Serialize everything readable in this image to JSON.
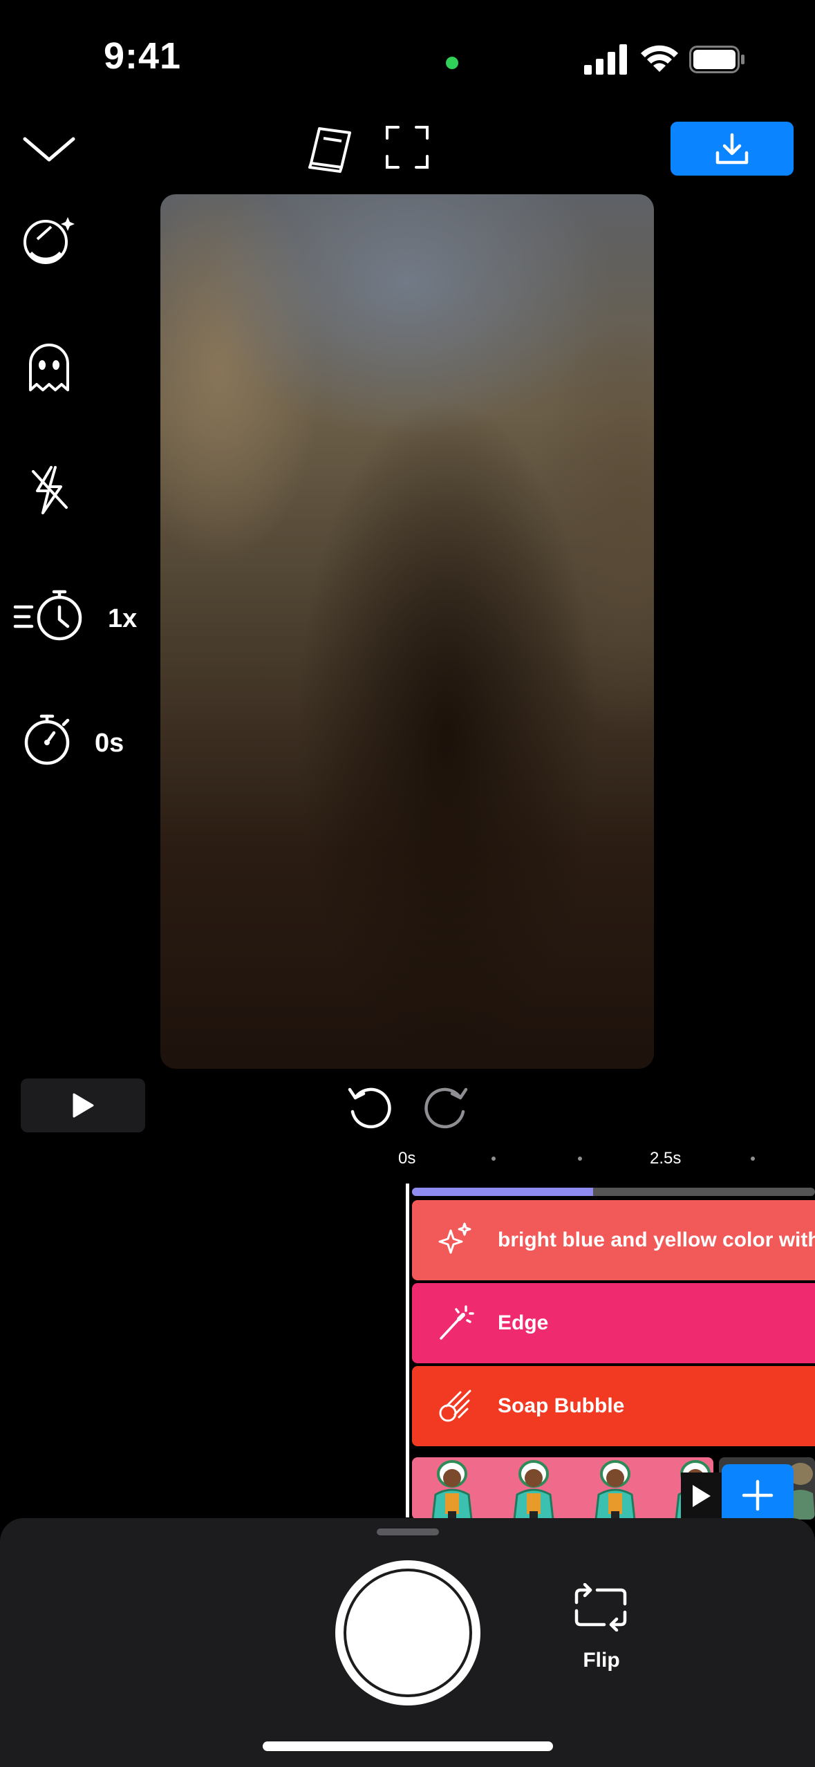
{
  "status_bar": {
    "time": "9:41"
  },
  "toolbar": {
    "export_icon": "download-icon",
    "export_color": "#0a84ff"
  },
  "side_tools": {
    "speed_label": "1x",
    "timer_label": "0s"
  },
  "timeline": {
    "ruler": [
      "0s",
      "2.5s"
    ],
    "progress": 0.45,
    "clips": [
      {
        "label": "bright blue and yellow color without r",
        "icon": "sparkles-icon",
        "color": "#f25a5a"
      },
      {
        "label": "Edge",
        "icon": "magic-wand-icon",
        "color": "#ef2a6e"
      },
      {
        "label": "Soap Bubble",
        "icon": "comet-icon",
        "color": "#f23a22"
      }
    ]
  },
  "bottom": {
    "flip_label": "Flip"
  }
}
